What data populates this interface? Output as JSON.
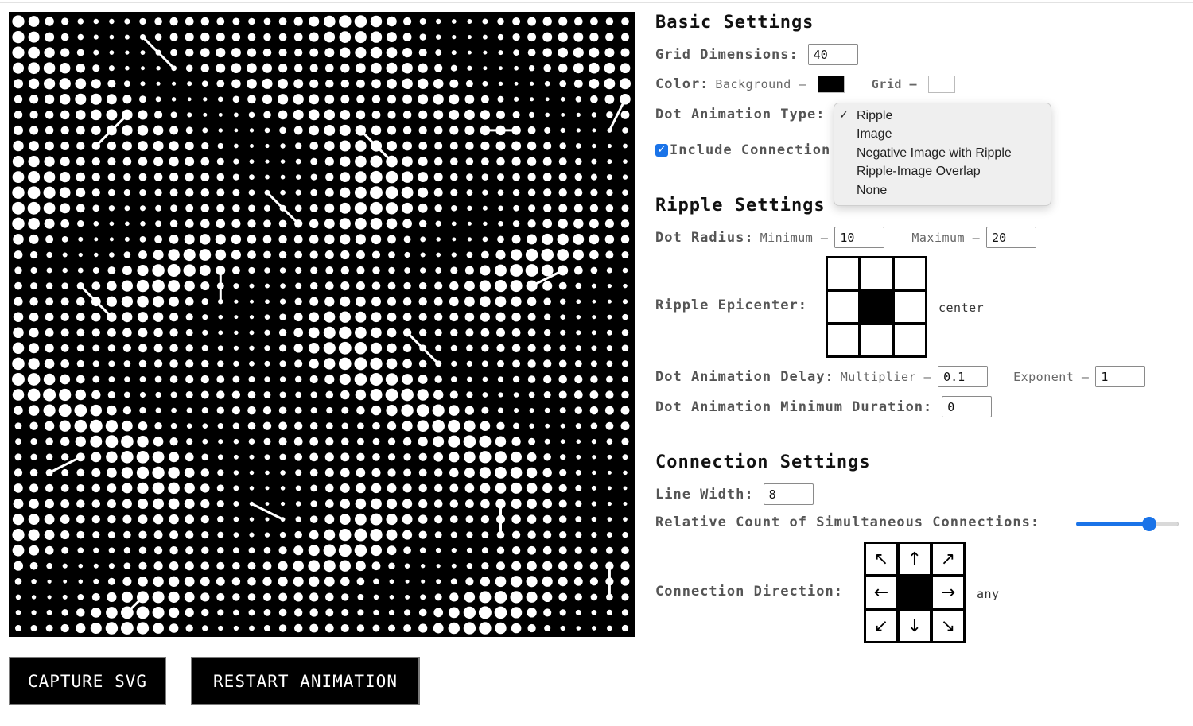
{
  "canvas": {
    "grid_dimensions": 40,
    "background_color": "#000000",
    "dot_color": "#ffffff"
  },
  "buttons": {
    "capture_label": "CAPTURE SVG",
    "restart_label": "RESTART ANIMATION"
  },
  "basic": {
    "title": "Basic Settings",
    "grid_label": "Grid Dimensions:",
    "grid_value": "40",
    "color_label": "Color:",
    "background_label": "Background –",
    "background_color": "#000000",
    "grid_color_label": "Grid –",
    "grid_color": "#ffffff",
    "anim_type_label": "Dot Animation Type:",
    "include_label": "Include Connection",
    "include_checked": true
  },
  "anim_type_menu": {
    "options": [
      "Ripple",
      "Image",
      "Negative Image with Ripple",
      "Ripple-Image Overlap",
      "None"
    ],
    "selected": "Ripple",
    "check_glyph": "✓"
  },
  "ripple": {
    "title": "Ripple Settings",
    "radius_label": "Dot Radius:",
    "min_label": "Minimum –",
    "min_value": "10",
    "max_label": "Maximum –",
    "max_value": "20",
    "epicenter_label": "Ripple Epicenter:",
    "epicenter_value": "center",
    "delay_label": "Dot Animation Delay:",
    "multiplier_label": "Multiplier –",
    "multiplier_value": "0.1",
    "exponent_label": "Exponent –",
    "exponent_value": "1",
    "min_duration_label": "Dot Animation Minimum Duration:",
    "min_duration_value": "0"
  },
  "connection": {
    "title": "Connection Settings",
    "line_width_label": "Line Width:",
    "line_width_value": "8",
    "relative_count_label": "Relative Count of Simultaneous Connections:",
    "relative_count_fraction": 0.75,
    "direction_label": "Connection Direction:",
    "direction_value": "any",
    "arrows": {
      "nw": "↖",
      "n": "↑",
      "ne": "↗",
      "w": "←",
      "e": "→",
      "sw": "↙",
      "s": "↓",
      "se": "↘"
    }
  }
}
